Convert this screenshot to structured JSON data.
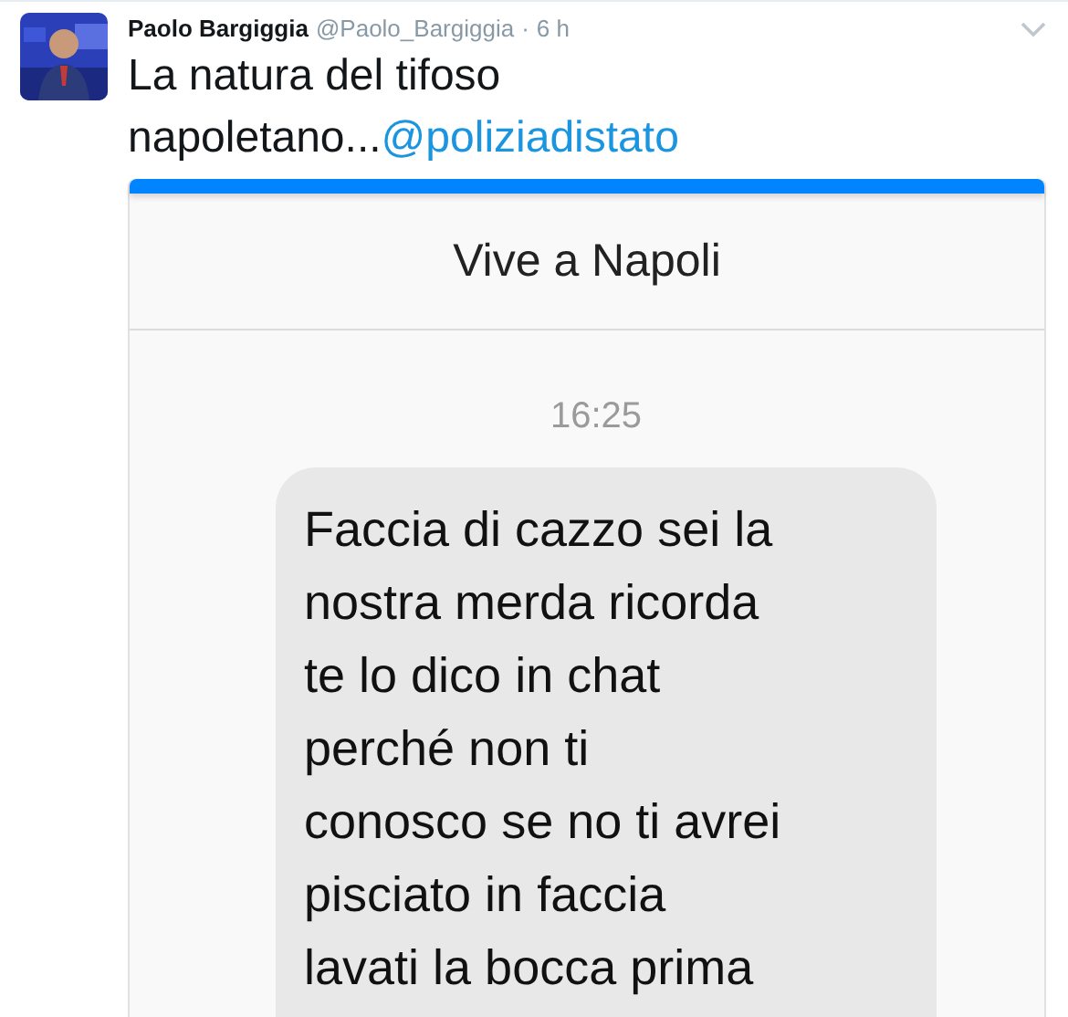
{
  "tweet": {
    "author": "Paolo Bargiggia",
    "handle": "@Paolo_Bargiggia",
    "separator": "·",
    "time": "6 h",
    "text": "La natura del tifoso napoletano...",
    "mention": "@poliziadistato"
  },
  "attachment": {
    "chat_title": "Vive a Napoli",
    "timestamp": "16:25",
    "message_lines": [
      "Faccia di cazzo sei la",
      "nostra merda ricorda",
      "te lo dico in chat",
      "perché non ti",
      "conosco se no ti avrei",
      "pisciato in faccia",
      "lavati la bocca prima"
    ]
  }
}
